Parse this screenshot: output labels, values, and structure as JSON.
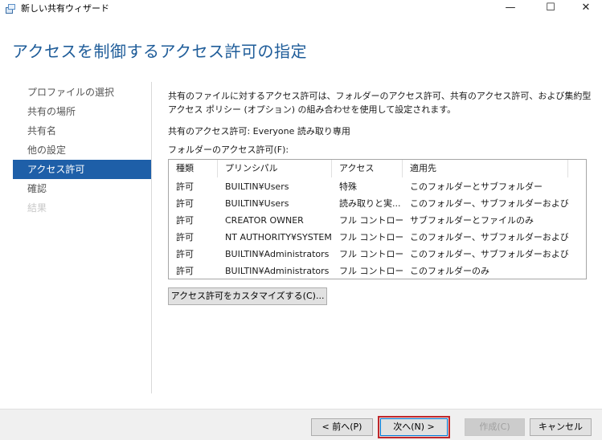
{
  "window": {
    "title": "新しい共有ウィザード",
    "minimize_glyph": "—",
    "maximize_glyph": "☐",
    "close_glyph": "✕"
  },
  "page_title": "アクセスを制御するアクセス許可の指定",
  "sidebar": {
    "items": [
      {
        "label": "プロファイルの選択",
        "state": "normal"
      },
      {
        "label": "共有の場所",
        "state": "normal"
      },
      {
        "label": "共有名",
        "state": "normal"
      },
      {
        "label": "他の設定",
        "state": "normal"
      },
      {
        "label": "アクセス許可",
        "state": "active"
      },
      {
        "label": "確認",
        "state": "normal"
      },
      {
        "label": "結果",
        "state": "disabled"
      }
    ]
  },
  "main": {
    "description": "共有のファイルに対するアクセス許可は、フォルダーのアクセス許可、共有のアクセス許可、および集約型アクセス ポリシー (オプション) の組み合わせを使用して設定されます。",
    "share_permission": "共有のアクセス許可: Everyone 読み取り専用",
    "folder_permission_label": "フォルダーのアクセス許可(F):",
    "table": {
      "columns": [
        "種類",
        "プリンシパル",
        "アクセス",
        "適用先"
      ],
      "rows": [
        [
          "許可",
          "BUILTIN¥Users",
          "特殊",
          "このフォルダーとサブフォルダー"
        ],
        [
          "許可",
          "BUILTIN¥Users",
          "読み取りと実...",
          "このフォルダー、サブフォルダーおよびファイル"
        ],
        [
          "許可",
          "CREATOR OWNER",
          "フル コントロール",
          "サブフォルダーとファイルのみ"
        ],
        [
          "許可",
          "NT AUTHORITY¥SYSTEM",
          "フル コントロール",
          "このフォルダー、サブフォルダーおよびファイル"
        ],
        [
          "許可",
          "BUILTIN¥Administrators",
          "フル コントロール",
          "このフォルダー、サブフォルダーおよびファイル"
        ],
        [
          "許可",
          "BUILTIN¥Administrators",
          "フル コントロール",
          "このフォルダーのみ"
        ]
      ]
    },
    "customize_button": "アクセス許可をカスタマイズする(C)..."
  },
  "footer": {
    "prev": "< 前へ(P)",
    "next": "次へ(N) >",
    "finish": "作成(C)",
    "cancel": "キャンセル"
  },
  "colors": {
    "accent": "#1e5fa8",
    "title": "#1e5c99",
    "focus_border": "#c0282c"
  }
}
